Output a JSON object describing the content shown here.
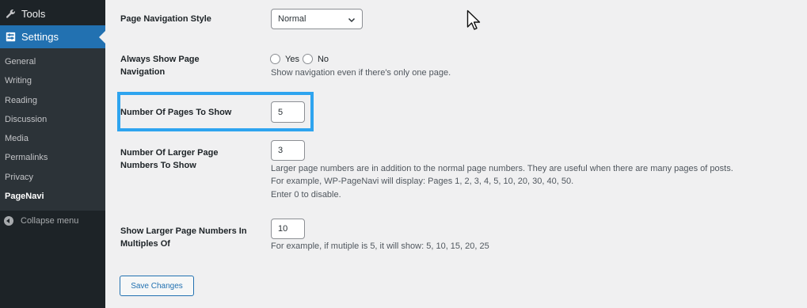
{
  "sidebar": {
    "tools_label": "Tools",
    "settings_label": "Settings",
    "submenu": [
      "General",
      "Writing",
      "Reading",
      "Discussion",
      "Media",
      "Permalinks",
      "Privacy",
      "PageNavi"
    ],
    "current_item": "PageNavi",
    "collapse_label": "Collapse menu"
  },
  "form": {
    "page_nav_style": {
      "label": "Page Navigation Style",
      "value": "Normal"
    },
    "always_show": {
      "label": "Always Show Page Navigation",
      "yes_label": "Yes",
      "no_label": "No",
      "description": "Show navigation even if there's only one page."
    },
    "num_pages": {
      "label": "Number Of Pages To Show",
      "value": "5"
    },
    "num_larger": {
      "label": "Number Of Larger Page Numbers To Show",
      "value": "3",
      "desc_line1": "Larger page numbers are in addition to the normal page numbers. They are useful when there are many pages of posts.",
      "desc_line2": "For example, WP-PageNavi will display: Pages 1, 2, 3, 4, 5, 10, 20, 30, 40, 50.",
      "desc_line3": "Enter 0 to disable."
    },
    "multiples": {
      "label": "Show Larger Page Numbers In Multiples Of",
      "value": "10",
      "description": "For example, if mutiple is 5, it will show: 5, 10, 15, 20, 25"
    },
    "save_label": "Save Changes"
  },
  "colors": {
    "sidebar_bg": "#1d2327",
    "active_menu": "#2271b1",
    "highlight_border": "#2ea4ef"
  }
}
